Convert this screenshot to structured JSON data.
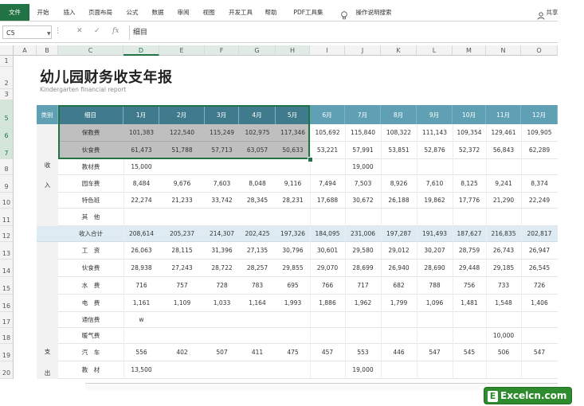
{
  "ribbon": {
    "tabs": [
      "文件",
      "开始",
      "插入",
      "页面布局",
      "公式",
      "数据",
      "审阅",
      "视图",
      "开发工具",
      "帮助",
      "PDF工具集",
      "操作说明搜索"
    ],
    "share": "共享"
  },
  "formula_bar": {
    "name_box": "C5",
    "content": "细目",
    "fx_label": "fx"
  },
  "columns": [
    "A",
    "B",
    "C",
    "D",
    "E",
    "F",
    "G",
    "H",
    "I",
    "J",
    "K",
    "L",
    "M",
    "N",
    "O"
  ],
  "rows": [
    "1",
    "2",
    "3",
    "5",
    "6",
    "7",
    "8",
    "9",
    "10",
    "11",
    "12",
    "13",
    "14",
    "15",
    "16",
    "17",
    "18",
    "19",
    "20"
  ],
  "report": {
    "title": "幼儿园财务收支年报",
    "subtitle": "Kindergarten financial report"
  },
  "table": {
    "header": [
      "类别",
      "细目",
      "1月",
      "2月",
      "3月",
      "4月",
      "5月",
      "6月",
      "7月",
      "8月",
      "9月",
      "10月",
      "11月",
      "12月"
    ],
    "income_label_1": "收",
    "income_label_2": "入",
    "expense_label_1": "支",
    "expense_label_2": "出",
    "income_rows": [
      {
        "item": "保教费",
        "values": [
          "101,383",
          "122,540",
          "115,249",
          "102,975",
          "117,346",
          "105,692",
          "115,840",
          "108,322",
          "111,143",
          "109,354",
          "129,461",
          "109,905"
        ]
      },
      {
        "item": "伙食费",
        "values": [
          "61,473",
          "51,788",
          "57,713",
          "63,057",
          "50,633",
          "53,221",
          "57,991",
          "53,851",
          "52,876",
          "52,372",
          "56,843",
          "62,289"
        ]
      },
      {
        "item": "教材费",
        "values": [
          "15,000",
          "",
          "",
          "",
          "",
          "",
          "19,000",
          "",
          "",
          "",
          "",
          ""
        ]
      },
      {
        "item": "园车费",
        "values": [
          "8,484",
          "9,676",
          "7,603",
          "8,048",
          "9,116",
          "7,494",
          "7,503",
          "8,926",
          "7,610",
          "8,125",
          "9,241",
          "8,374"
        ]
      },
      {
        "item": "特色班",
        "values": [
          "22,274",
          "21,233",
          "33,742",
          "28,345",
          "28,231",
          "17,688",
          "30,672",
          "26,188",
          "19,862",
          "17,776",
          "21,290",
          "22,249"
        ]
      },
      {
        "item": "其　他",
        "values": [
          "",
          "",
          "",
          "",
          "",
          "",
          "",
          "",
          "",
          "",
          "",
          ""
        ]
      }
    ],
    "income_total": {
      "item": "收入合计",
      "values": [
        "208,614",
        "205,237",
        "214,307",
        "202,425",
        "197,326",
        "184,095",
        "231,006",
        "197,287",
        "191,493",
        "187,627",
        "216,835",
        "202,817"
      ]
    },
    "expense_rows": [
      {
        "item": "工　资",
        "values": [
          "26,063",
          "28,115",
          "31,396",
          "27,135",
          "30,796",
          "30,601",
          "29,580",
          "29,012",
          "30,207",
          "28,759",
          "26,743",
          "26,947"
        ]
      },
      {
        "item": "伙食费",
        "values": [
          "28,938",
          "27,243",
          "28,722",
          "28,257",
          "29,855",
          "29,070",
          "28,699",
          "26,940",
          "28,690",
          "29,448",
          "29,185",
          "26,545"
        ]
      },
      {
        "item": "水　费",
        "values": [
          "716",
          "757",
          "728",
          "783",
          "695",
          "766",
          "717",
          "682",
          "788",
          "756",
          "733",
          "726"
        ]
      },
      {
        "item": "电　费",
        "values": [
          "1,161",
          "1,109",
          "1,033",
          "1,164",
          "1,993",
          "1,886",
          "1,962",
          "1,799",
          "1,096",
          "1,481",
          "1,548",
          "1,406"
        ]
      },
      {
        "item": "通信费",
        "values": [
          "w",
          "",
          "",
          "",
          "",
          "",
          "",
          "",
          "",
          "",
          "",
          ""
        ]
      },
      {
        "item": "暖气费",
        "values": [
          "",
          "",
          "",
          "",
          "",
          "",
          "",
          "",
          "",
          "",
          "10,000",
          ""
        ]
      },
      {
        "item": "汽　车",
        "values": [
          "556",
          "402",
          "507",
          "411",
          "475",
          "457",
          "553",
          "446",
          "547",
          "545",
          "506",
          "547"
        ]
      },
      {
        "item": "教　材",
        "values": [
          "13,500",
          "",
          "",
          "",
          "",
          "",
          "19,000",
          "",
          "",
          "",
          "",
          ""
        ]
      }
    ]
  },
  "watermark": {
    "letter": "E",
    "text": "Excelcn.com"
  },
  "colors": {
    "excel_green": "#217346",
    "header_teal": "#5fa0b5",
    "header_dark": "#3f7b8d",
    "selection_gray": "#bfbfbf",
    "total_row": "#deebf2"
  }
}
